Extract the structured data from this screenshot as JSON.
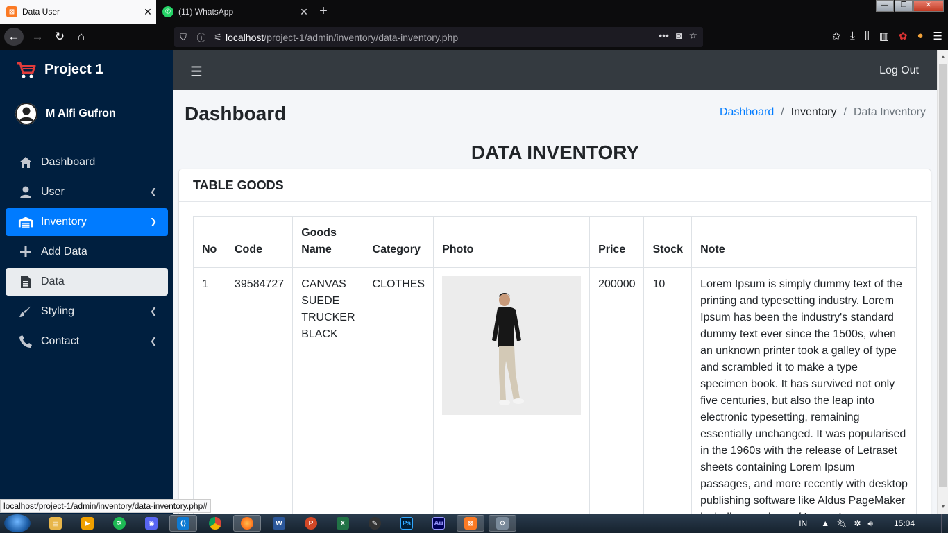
{
  "browser": {
    "tabs": [
      {
        "title": "Data User",
        "active": true
      },
      {
        "title": "(11) WhatsApp",
        "active": false
      }
    ],
    "url_host": "localhost",
    "url_path": "/project-1/admin/inventory/data-inventory.php",
    "status_url": "localhost/project-1/admin/inventory/data-inventory.php#"
  },
  "sidebar": {
    "brand": "Project 1",
    "user": "M Alfi Gufron",
    "items": [
      {
        "label": "Dashboard",
        "icon": "home-icon"
      },
      {
        "label": "User",
        "icon": "user-icon"
      },
      {
        "label": "Inventory",
        "icon": "warehouse-icon"
      },
      {
        "label": "Add Data",
        "icon": "plus-icon"
      },
      {
        "label": "Data",
        "icon": "file-icon"
      },
      {
        "label": "Styling",
        "icon": "brush-icon"
      },
      {
        "label": "Contact",
        "icon": "phone-icon"
      }
    ]
  },
  "topnav": {
    "logout": "Log Out"
  },
  "page": {
    "title": "Dashboard",
    "breadcrumb": [
      "Dashboard",
      "Inventory",
      "Data Inventory"
    ],
    "heading": "DATA INVENTORY"
  },
  "card": {
    "title": "TABLE GOODS",
    "columns": [
      "No",
      "Code",
      "Goods Name",
      "Category",
      "Photo",
      "Price",
      "Stock",
      "Note"
    ],
    "rows": [
      {
        "no": "1",
        "code": "39584727",
        "name": "CANVAS SUEDE TRUCKER BLACK",
        "category": "CLOTHES",
        "price": "200000",
        "stock": "10",
        "note": "Lorem Ipsum is simply dummy text of the printing and typesetting industry. Lorem Ipsum has been the industry's standard dummy text ever since the 1500s, when an unknown printer took a galley of type and scrambled it to make a type specimen book. It has survived not only five centuries, but also the leap into electronic typesetting, remaining essentially unchanged. It was popularised in the 1960s with the release of Letraset sheets containing Lorem Ipsum passages, and more recently with desktop publishing software like Aldus PageMaker including versions of Lorem Ipsum."
      }
    ]
  },
  "taskbar": {
    "lang": "IN",
    "time": "15:04"
  },
  "colors": {
    "sidebar": "#001f3f",
    "active": "#007bff",
    "topnav": "#343a40"
  }
}
